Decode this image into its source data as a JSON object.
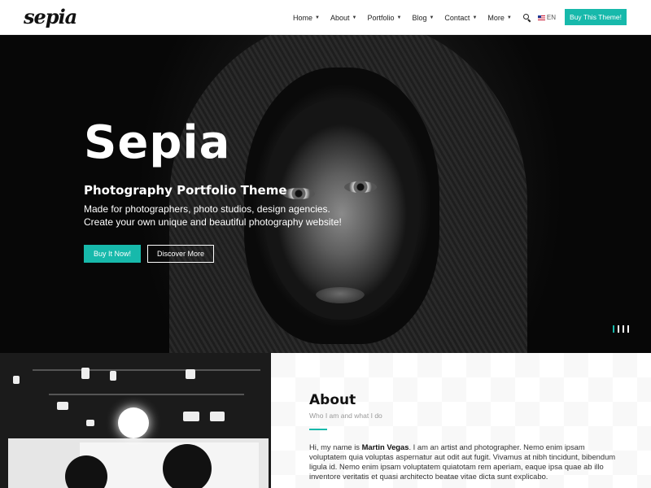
{
  "header": {
    "logo": "sepia",
    "nav": [
      {
        "label": "Home"
      },
      {
        "label": "Portfolio"
      },
      {
        "label": "About"
      },
      {
        "label": "Blog"
      },
      {
        "label": "Contact"
      },
      {
        "label": "More"
      }
    ],
    "nav_order_fix": [
      "Home",
      "About",
      "Portfolio",
      "Blog",
      "Contact",
      "More"
    ],
    "search_icon": "search-icon",
    "lang": "EN",
    "buy_button": "Buy This Theme!",
    "accent_color": "#17b9ab"
  },
  "hero": {
    "title": "Sepia",
    "subtitle": "Photography Portfolio Theme",
    "desc_line1": "Made for photographers, photo studios, design agencies.",
    "desc_line2": "Create your own unique and beautiful photography website!",
    "primary_button": "Buy It Now!",
    "secondary_button": "Discover More",
    "slides": 4,
    "active_slide": 1
  },
  "about": {
    "title": "About",
    "subtitle": "Who I am and what I do",
    "text_intro": "Hi, my name is ",
    "text_name": "Martin Vegas",
    "text_body": ". I am an artist and photographer. Nemo enim ipsam voluptatem quia voluptas aspernatur aut odit aut fugit. Vivamus at nibh tincidunt, bibendum ligula id. Nemo enim ipsam voluptatem quiatotam rem aperiam, eaque ipsa quae ab illo inventore veritatis et quasi architecto beatae vitae dicta sunt explicabo."
  }
}
